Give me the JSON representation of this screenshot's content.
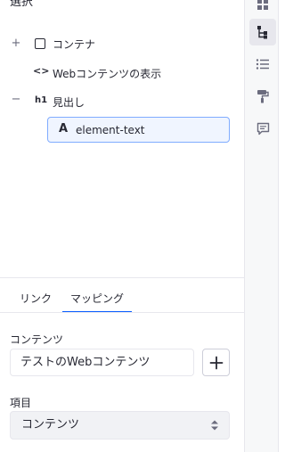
{
  "panel": {
    "title": "選択"
  },
  "tree": {
    "container": {
      "toggle": "+",
      "label": "コンテナ"
    },
    "web_content": {
      "icon_text": "<>",
      "label": "Webコンテンツの表示"
    },
    "heading": {
      "toggle": "−",
      "icon_text": "h1",
      "label": "見出し"
    },
    "element_text": {
      "icon_text": "A",
      "label": "element-text"
    }
  },
  "tabs": [
    {
      "label": "リンク",
      "active": false
    },
    {
      "label": "マッピング",
      "active": true
    }
  ],
  "fields": {
    "content_label": "コンテンツ",
    "content_value": "テストのWebコンテンツ",
    "item_label": "項目",
    "item_selected": "コンテンツ"
  },
  "toolbar": {
    "icons": [
      "page-elements-icon",
      "page-structure-icon",
      "browser-list-icon",
      "paint-roller-icon",
      "comments-icon"
    ],
    "active": "page-structure-icon"
  },
  "colors": {
    "accent": "#0b5fff",
    "selected_bg": "#f0f5ff",
    "selected_border": "#80acff",
    "toolbar_bg": "#f7f8f9",
    "select_bg": "#f1f2f5"
  }
}
